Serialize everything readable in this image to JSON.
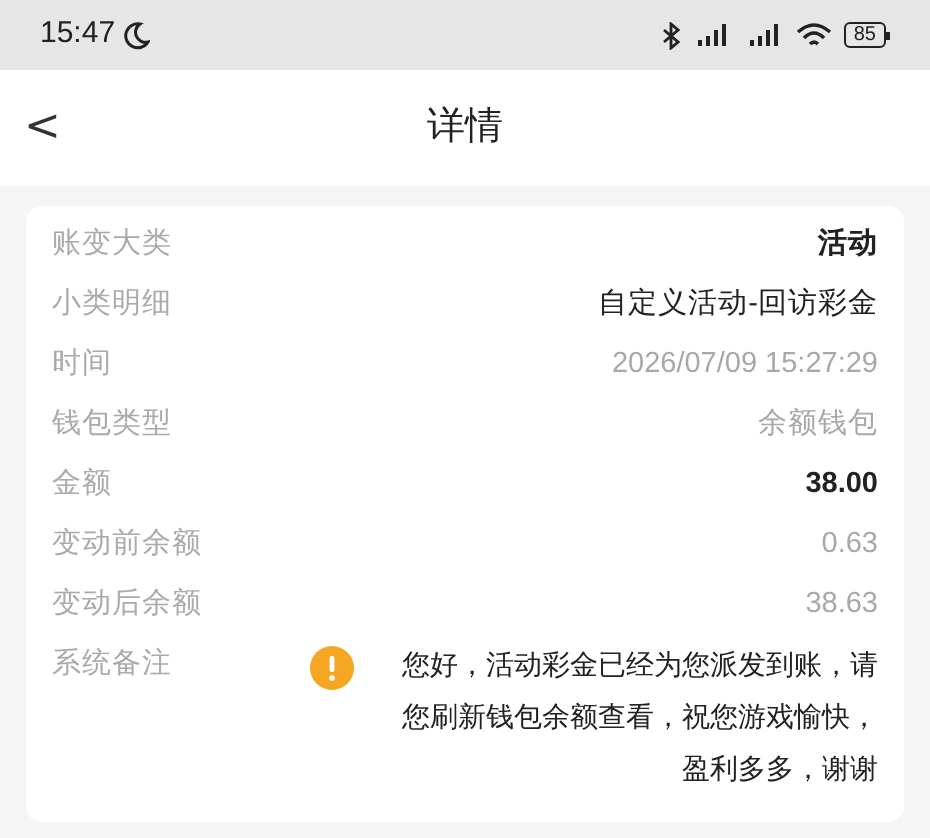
{
  "status_bar": {
    "time": "15:47",
    "battery": "85"
  },
  "header": {
    "back": "<",
    "title": "详情"
  },
  "rows": [
    {
      "label": "账变大类",
      "value": "活动",
      "kind": "emphasis"
    },
    {
      "label": "小类明细",
      "value": "自定义活动-回访彩金",
      "kind": "normal"
    },
    {
      "label": "时间",
      "value": "2026/07/09 15:27:29",
      "kind": "muted"
    },
    {
      "label": "钱包类型",
      "value": "余额钱包",
      "kind": "muted"
    },
    {
      "label": "金额",
      "value": "38.00",
      "kind": "emphasis"
    },
    {
      "label": "变动前余额",
      "value": "0.63",
      "kind": "muted"
    },
    {
      "label": "变动后余额",
      "value": "38.63",
      "kind": "muted"
    },
    {
      "label": "系统备注",
      "value": "您好，活动彩金已经为您派发到账，请您刷新钱包余额查看，祝您游戏愉快，盈利多多，谢谢",
      "kind": "note"
    }
  ]
}
